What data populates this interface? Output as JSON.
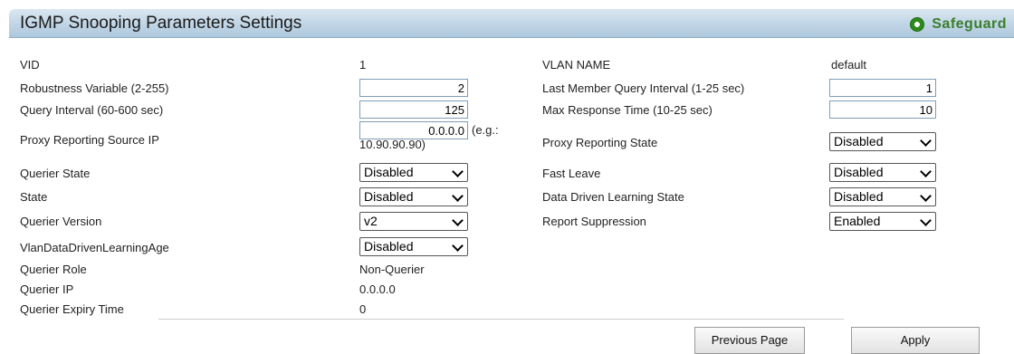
{
  "header": {
    "title": "IGMP Snooping Parameters Settings",
    "safeguard_label": "Safeguard"
  },
  "left": {
    "vid_label": "VID",
    "vid_value": "1",
    "robustness_label": "Robustness Variable (2-255)",
    "robustness_value": "2",
    "query_interval_label": "Query Interval (60-600 sec)",
    "query_interval_value": "125",
    "proxy_ip_label": "Proxy Reporting Source IP",
    "proxy_ip_value": "0.0.0.0",
    "proxy_ip_hint_1": "(e.g.:",
    "proxy_ip_hint_2": "10.90.90.90)",
    "querier_state_label": "Querier State",
    "querier_state_value": "Disabled",
    "state_label": "State",
    "state_value": "Disabled",
    "querier_version_label": "Querier Version",
    "querier_version_value": "v2",
    "vlan_ddl_age_label": "VlanDataDrivenLearningAge",
    "vlan_ddl_age_value": "Disabled",
    "querier_role_label": "Querier Role",
    "querier_role_value": "Non-Querier",
    "querier_ip_label": "Querier IP",
    "querier_ip_value": "0.0.0.0",
    "querier_expiry_label": "Querier Expiry Time",
    "querier_expiry_value": "0"
  },
  "right": {
    "vlan_name_label": "VLAN NAME",
    "vlan_name_value": "default",
    "last_member_label": "Last Member Query Interval (1-25 sec)",
    "last_member_value": "1",
    "max_response_label": "Max Response Time (10-25 sec)",
    "max_response_value": "10",
    "proxy_state_label": "Proxy Reporting State",
    "proxy_state_value": "Disabled",
    "fast_leave_label": "Fast Leave",
    "fast_leave_value": "Disabled",
    "ddl_state_label": "Data Driven Learning State",
    "ddl_state_value": "Disabled",
    "report_suppression_label": "Report Suppression",
    "report_suppression_value": "Enabled"
  },
  "buttons": {
    "previous_label": "Previous Page",
    "apply_label": "Apply"
  },
  "colors": {
    "header_gradient_top": "#dbe7f1",
    "header_gradient_bottom": "#aec8dc",
    "safeguard_green": "#3a7d2e"
  }
}
